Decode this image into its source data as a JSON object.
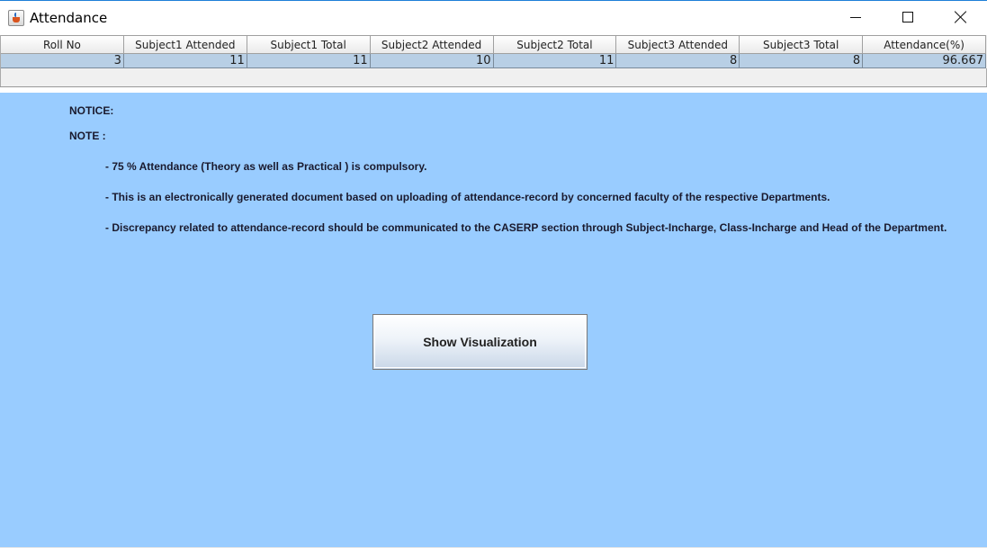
{
  "window": {
    "title": "Attendance",
    "icons": {
      "app": "java-cup-icon",
      "minimize": "minimize-icon",
      "maximize": "maximize-icon",
      "close": "close-icon"
    }
  },
  "table": {
    "columns": [
      "Roll No",
      "Subject1 Attended",
      "Subject1 Total",
      "Subject2 Attended",
      "Subject2 Total",
      "Subject3 Attended",
      "Subject3 Total",
      "Attendance(%)"
    ],
    "rows": [
      [
        "3",
        "11",
        "11",
        "10",
        "11",
        "8",
        "8",
        "96.667"
      ]
    ],
    "selected_row_color": "#b8cfe5"
  },
  "notice": {
    "notice_label": "NOTICE:",
    "note_label": "NOTE :",
    "lines": [
      "- 75 % Attendance (Theory as well as Practical ) is compulsory.",
      "- This is an electronically generated document based on uploading of attendance-record by concerned faculty of the respective Departments.",
      "- Discrepancy related to attendance-record should be communicated to the CASERP section through Subject-Incharge, Class-Incharge and Head of the Department."
    ]
  },
  "actions": {
    "show_visualization": "Show Visualization"
  },
  "colors": {
    "panel_background": "#99ccff",
    "text": "#1a1a2e"
  }
}
